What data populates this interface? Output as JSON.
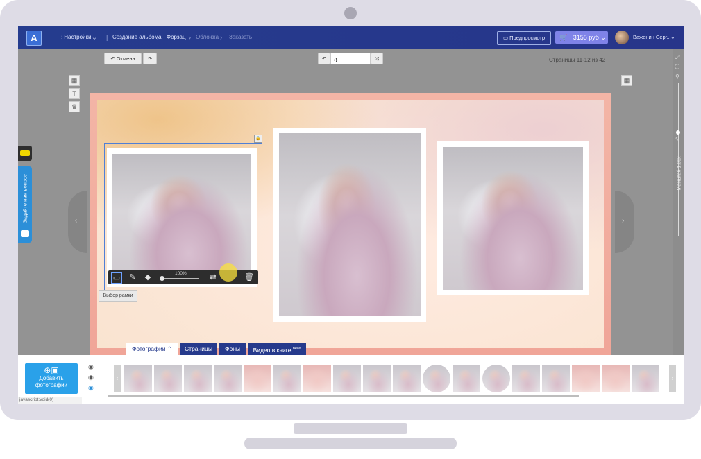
{
  "topbar": {
    "logo": "A",
    "settings": "Настройки",
    "breadcrumb": [
      "Создание альбома",
      "Форзац",
      "Обложка",
      "Заказать"
    ],
    "preview": "Предпросмотр",
    "price": "3155 руб",
    "username": "Важенин Серг..."
  },
  "editor": {
    "undo": "Отмена",
    "pages_info": "Страницы 11-12 из 42",
    "zoom_label": "Масштаб",
    "zoom_value": "1.00x",
    "photo_zoom": "100%",
    "tooltip": "Выбор рамки",
    "feedback": "Задайте нам вопрос"
  },
  "tabs": [
    {
      "label": "Фотографии"
    },
    {
      "label": "Страницы"
    },
    {
      "label": "Фоны"
    },
    {
      "label": "Видео в книге",
      "badge": "new!"
    }
  ],
  "panel": {
    "add_photos": "Добавить фотографии",
    "status": "javascript:void(0)"
  },
  "colors": {
    "topbar": "#253c8e",
    "accent": "#2aa1e9",
    "price": "#7f83e8"
  }
}
